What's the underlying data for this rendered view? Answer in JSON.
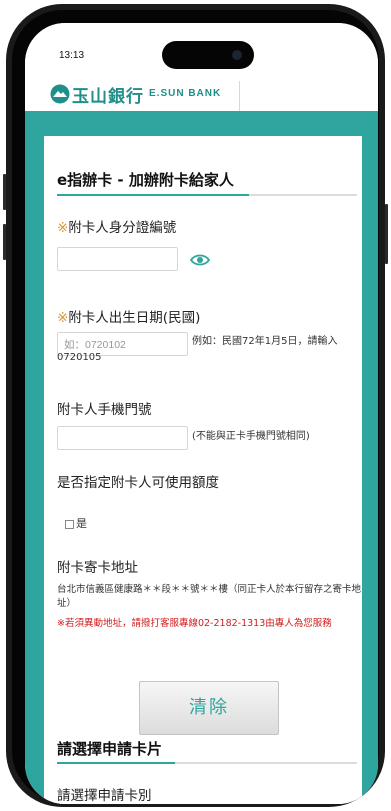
{
  "status_bar": {
    "time": "13:13"
  },
  "header": {
    "bank_name_cn": "玉山銀行",
    "bank_name_en": "E.SUN BANK",
    "brand_color": "#1f8f8a",
    "band_color": "#2ea69f"
  },
  "form": {
    "section_title": "e指辦卡 - 加辦附卡給家人",
    "id_field": {
      "required_mark": "※",
      "label": "附卡人身分證編號",
      "value": "",
      "toggle_icon": "eye-icon"
    },
    "birthdate_field": {
      "required_mark": "※",
      "label": "附卡人出生日期(民國)",
      "placeholder": "如：0720102",
      "hint": "例如：民國72年1月5日，請輸入0720105"
    },
    "phone_field": {
      "label": "附卡人手機門號",
      "value": "",
      "hint": "(不能與正卡手機門號相同)"
    },
    "credit_limit": {
      "label": "是否指定附卡人可使用額度",
      "checkbox_label": "是",
      "checked": false
    },
    "mailing_address": {
      "label": "附卡寄卡地址",
      "address": "台北市信義區健康路＊＊段＊＊號＊＊樓（同正卡人於本行留存之寄卡地址）",
      "warning": "※若須異動地址，請撥打客服專線02-2182-1313由專人為您服務",
      "warning_color": "#d21c1c"
    },
    "clear_button": "清除"
  },
  "card_section": {
    "section_title": "請選擇申請卡片",
    "subtitle": "請選擇申請卡別"
  }
}
